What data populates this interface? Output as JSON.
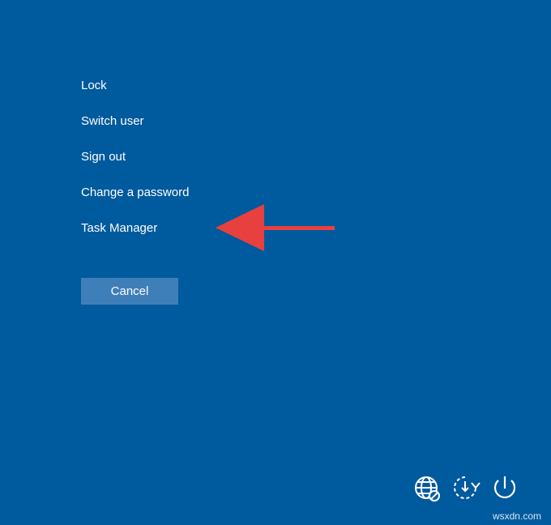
{
  "menu": {
    "items": [
      {
        "label": "Lock"
      },
      {
        "label": "Switch user"
      },
      {
        "label": "Sign out"
      },
      {
        "label": "Change a password"
      },
      {
        "label": "Task Manager"
      }
    ]
  },
  "cancel_button": {
    "label": "Cancel"
  },
  "annotation": {
    "color": "#e8403e",
    "points_to": "Task Manager"
  },
  "tray": {
    "icons": [
      "network-icon",
      "ease-of-access-icon",
      "power-icon"
    ]
  },
  "watermark": "wsxdn.com",
  "colors": {
    "background": "#005a9e",
    "button": "#3f7fb9",
    "text": "#ffffff"
  }
}
